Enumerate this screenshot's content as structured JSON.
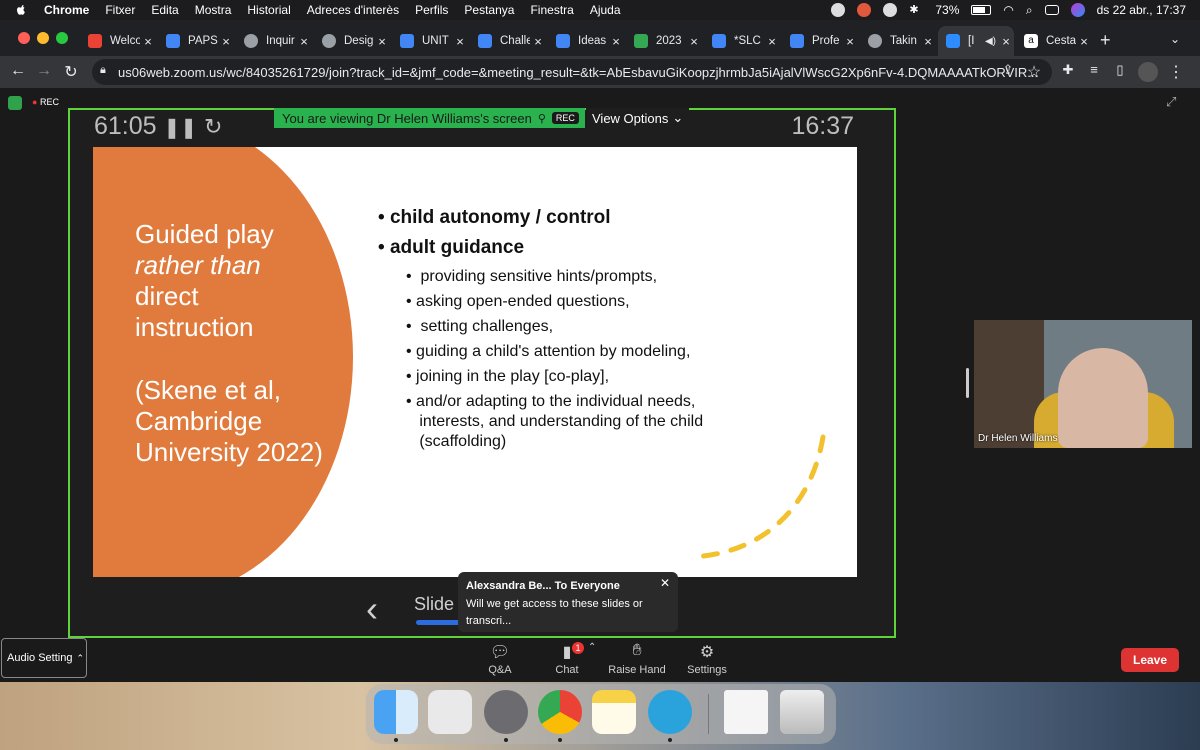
{
  "menubar": {
    "app": "Chrome",
    "items": [
      "Fitxer",
      "Edita",
      "Mostra",
      "Historial",
      "Adreces d'interès",
      "Perfils",
      "Pestanya",
      "Finestra",
      "Ajuda"
    ],
    "battery": "73%",
    "clock": "ds 22 abr., 17:37"
  },
  "tabs": [
    {
      "label": "Welco",
      "color": "#ea4335"
    },
    {
      "label": "PAPS",
      "color": "#4285f4"
    },
    {
      "label": "Inquir",
      "color": "#9aa0a6"
    },
    {
      "label": "Desig",
      "color": "#9aa0a6"
    },
    {
      "label": "UNIT",
      "color": "#4285f4"
    },
    {
      "label": "Challe",
      "color": "#4285f4"
    },
    {
      "label": "Ideas",
      "color": "#4285f4"
    },
    {
      "label": "2023",
      "color": "#34a853"
    },
    {
      "label": "*SLC",
      "color": "#4285f4"
    },
    {
      "label": "Profe",
      "color": "#4285f4"
    },
    {
      "label": "Takin",
      "color": "#9aa0a6"
    },
    {
      "label": "[I",
      "color": "#2d8cff"
    },
    {
      "label": "Cesta",
      "color": "#ffffff"
    }
  ],
  "new_tab": "+",
  "address": {
    "url": "us06web.zoom.us/wc/84035261729/join?track_id=&jmf_code=&meeting_result=&tk=AbEsbavuGiKoopzjhrmbJa5iAjalVlWscG2Xp6nFv-4.DQMAAAATkORVIR..."
  },
  "zoom": {
    "rec_label": "REC",
    "banner": "You are viewing Dr Helen Williams's screen",
    "banner_rec": "REC",
    "view_options": "View Options",
    "timer_left": "61:05",
    "timer_right": "16:37",
    "slide": {
      "title_line1": "Guided play",
      "title_line2": "rather than",
      "title_line3": "direct",
      "title_line4": "instruction",
      "cite1": "(Skene et al,",
      "cite2": "Cambridge",
      "cite3": "University 2022)",
      "b1": "child autonomy / control",
      "b2": "adult guidance",
      "s1": "providing sensitive hints/prompts,",
      "s2": "asking open-ended questions,",
      "s3": "setting challenges,",
      "s4": "guiding a child's attention by modeling,",
      "s5": "joining in the play [co-play],",
      "s6": "and/or adapting to the individual needs,",
      "s6b": "interests, and understanding of the child",
      "s6c": "(scaffolding)"
    },
    "slide_nav_text": "Slide",
    "chat_popup": {
      "from": "Alexsandra Be... To Everyone",
      "message": "Will we get access to these slides or transcri..."
    },
    "participant_name": "Dr Helen Williams",
    "controls": {
      "audio": "Audio Setting",
      "qa": "Q&A",
      "chat": "Chat",
      "chat_badge": "1",
      "raise_hand": "Raise Hand",
      "settings": "Settings",
      "leave": "Leave"
    }
  },
  "dock_apps": [
    "Finder",
    "Launchpad",
    "System Settings",
    "Chrome",
    "Notes",
    "Telegram",
    "Downloads",
    "Trash"
  ]
}
